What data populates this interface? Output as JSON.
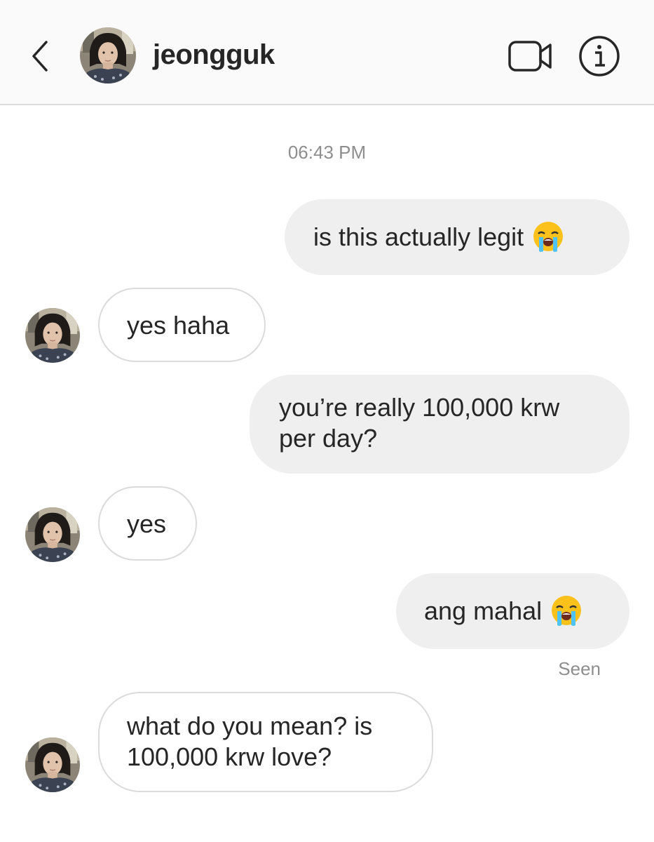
{
  "header": {
    "username": "jeongguk",
    "icons": {
      "back": "chevron-left-icon",
      "video": "video-call-icon",
      "info": "info-icon"
    }
  },
  "conversation": {
    "timestamp": "06:43 PM",
    "messages": [
      {
        "from": "me",
        "text": "is this actually legit",
        "emoji": "loudly-crying-face-emoji"
      },
      {
        "from": "them",
        "text": "yes haha"
      },
      {
        "from": "me",
        "lines": [
          "you’re really 100,000 krw",
          "per day?"
        ]
      },
      {
        "from": "them",
        "text": "yes"
      },
      {
        "from": "me",
        "text": "ang mahal",
        "emoji": "loudly-crying-face-emoji"
      },
      {
        "from": "them",
        "lines": [
          "what do you mean? is",
          "100,000 krw love?"
        ]
      }
    ],
    "seen_label": "Seen"
  },
  "colors": {
    "header_bg": "#fafafa",
    "sent_bubble": "#efefef",
    "received_border": "#dbdbdb",
    "muted_text": "#8e8e8e"
  }
}
